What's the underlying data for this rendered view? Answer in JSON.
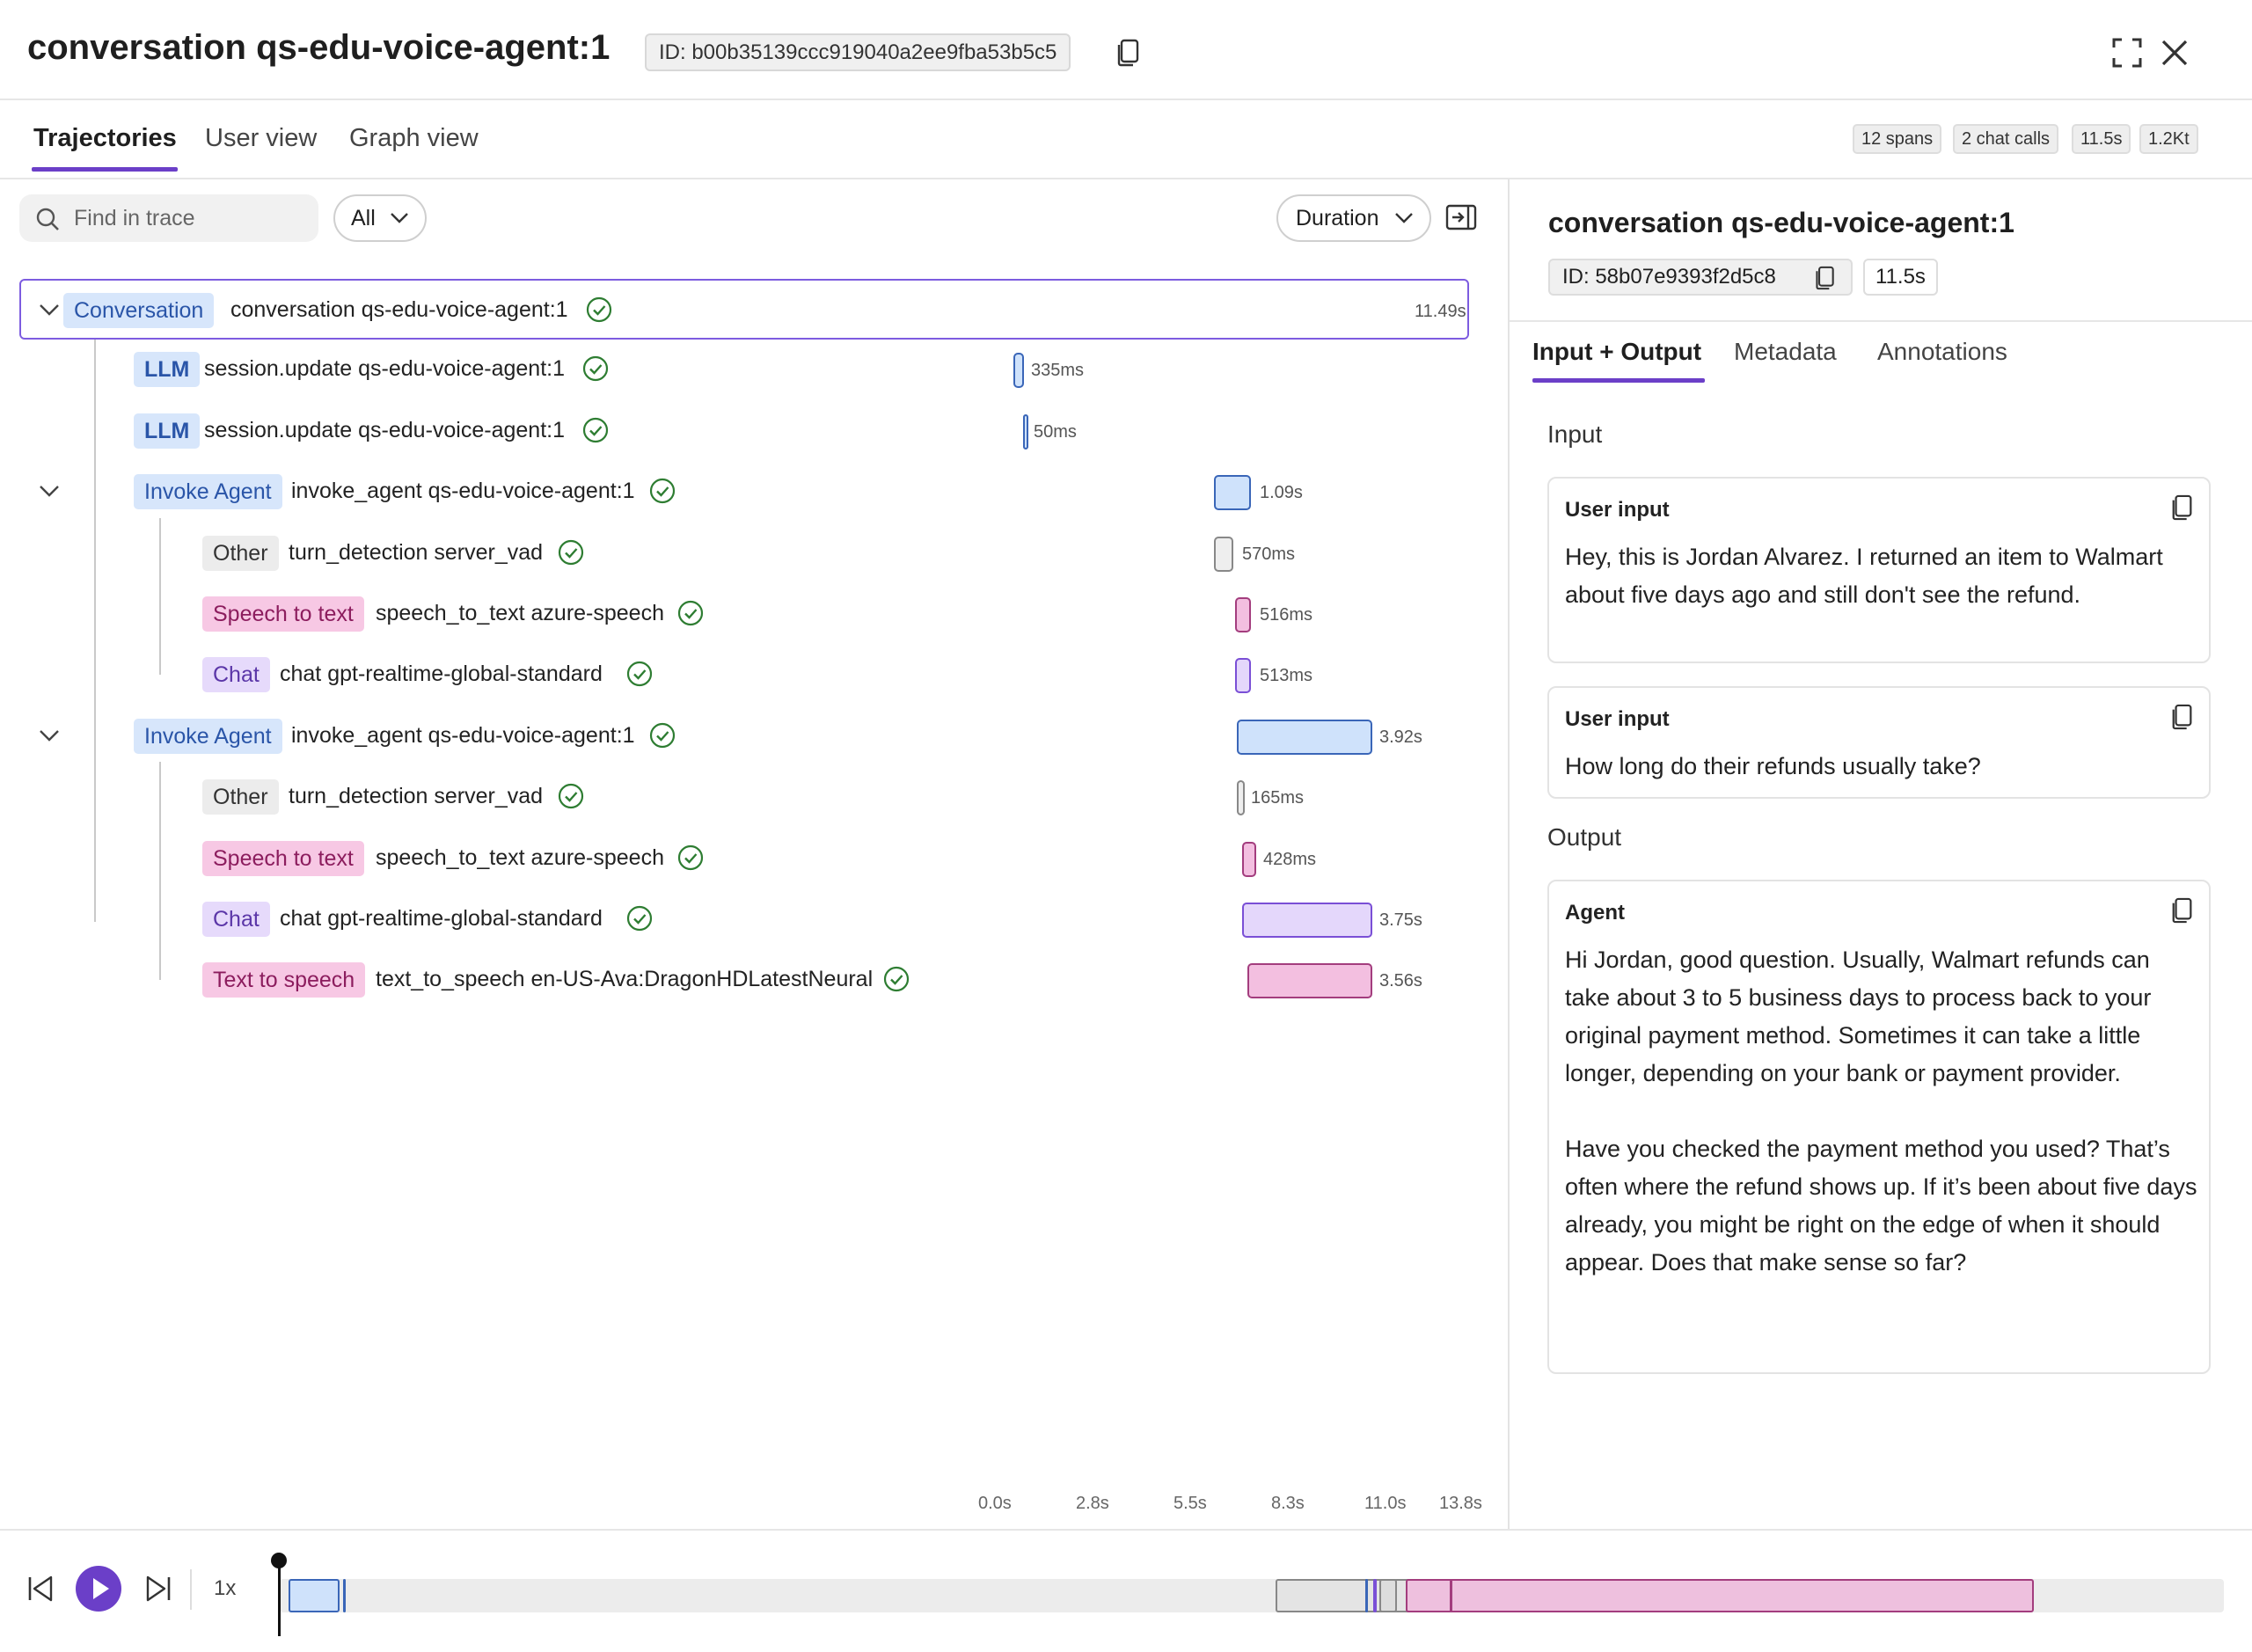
{
  "header": {
    "title": "conversation qs-edu-voice-agent:1",
    "id_label": "ID: b00b35139ccc919040a2ee9fba53b5c5"
  },
  "tabs": [
    {
      "label": "Trajectories",
      "active": true
    },
    {
      "label": "User view",
      "active": false
    },
    {
      "label": "Graph view",
      "active": false
    }
  ],
  "stats": [
    "12 spans",
    "2 chat calls",
    "11.5s",
    "1.2Kt"
  ],
  "toolbar": {
    "search_placeholder": "Find in trace",
    "filter_value": "All",
    "sort_value": "Duration"
  },
  "tree": [
    {
      "type": "Conversation",
      "name": "conversation qs-edu-voice-agent:1",
      "duration": "11.49s",
      "depth": 0,
      "expanded": true,
      "status": "ok",
      "selected": true,
      "color": "#cfe2fb"
    },
    {
      "type": "LLM",
      "name": "session.update qs-edu-voice-agent:1",
      "duration": "335ms",
      "depth": 1,
      "status": "ok",
      "color": "#cfe2fb"
    },
    {
      "type": "LLM",
      "name": "session.update qs-edu-voice-agent:1",
      "duration": "50ms",
      "depth": 1,
      "status": "ok",
      "color": "#cfe2fb"
    },
    {
      "type": "Invoke Agent",
      "name": "invoke_agent qs-edu-voice-agent:1",
      "duration": "1.09s",
      "depth": 1,
      "expanded": true,
      "status": "ok",
      "color": "#cfe2fb"
    },
    {
      "type": "Other",
      "name": "turn_detection server_vad",
      "duration": "570ms",
      "depth": 2,
      "status": "ok",
      "color": "#eeeeee"
    },
    {
      "type": "Speech to text",
      "name": "speech_to_text azure-speech",
      "duration": "516ms",
      "depth": 2,
      "status": "ok",
      "color": "#f3bfe0"
    },
    {
      "type": "Chat",
      "name": "chat gpt-realtime-global-standard",
      "duration": "513ms",
      "depth": 2,
      "status": "ok",
      "color": "#e4d7fb"
    },
    {
      "type": "Invoke Agent",
      "name": "invoke_agent qs-edu-voice-agent:1",
      "duration": "3.92s",
      "depth": 1,
      "expanded": true,
      "status": "ok",
      "color": "#cfe2fb"
    },
    {
      "type": "Other",
      "name": "turn_detection server_vad",
      "duration": "165ms",
      "depth": 2,
      "status": "ok",
      "color": "#eeeeee"
    },
    {
      "type": "Speech to text",
      "name": "speech_to_text azure-speech",
      "duration": "428ms",
      "depth": 2,
      "status": "ok",
      "color": "#f3bfe0"
    },
    {
      "type": "Chat",
      "name": "chat gpt-realtime-global-standard",
      "duration": "3.75s",
      "depth": 2,
      "status": "ok",
      "color": "#e4d7fb"
    },
    {
      "type": "Text to speech",
      "name": "text_to_speech en-US-Ava:DragonHDLatestNeural",
      "duration": "3.56s",
      "depth": 2,
      "status": "ok",
      "color": "#f3bfe0"
    }
  ],
  "axis_ticks": [
    "0.0s",
    "2.8s",
    "5.5s",
    "8.3s",
    "11.0s",
    "13.8s"
  ],
  "detail": {
    "title": "conversation qs-edu-voice-agent:1",
    "id_label": "ID: 58b07e9393f2d5c8",
    "duration": "11.5s",
    "tabs": [
      {
        "label": "Input + Output",
        "active": true
      },
      {
        "label": "Metadata",
        "active": false
      },
      {
        "label": "Annotations",
        "active": false
      }
    ],
    "input_label": "Input",
    "output_label": "Output",
    "inputs": [
      {
        "role": "User input",
        "text": "Hey, this is Jordan Alvarez. I returned an item to Walmart about five days ago and still don't see the refund."
      },
      {
        "role": "User input",
        "text": "How long do their refunds usually take?"
      }
    ],
    "output": {
      "role": "Agent",
      "text": "Hi Jordan, good question. Usually, Walmart refunds can take about 3 to 5 business days to process back to your original payment method. Sometimes it can take a little longer, depending on your bank or payment provider.\n\nHave you checked the payment method you used? That’s often where the refund shows up. If it’s been about five days already, you might be right on the edge of when it should appear. Does that make sense so far?"
    }
  },
  "player": {
    "speed": "1x"
  },
  "colors": {
    "accent": "#6b3fc8",
    "success": "#2e7d32",
    "llm_blue": "#cfe2fb",
    "speech_pink": "#f3bfe0",
    "chat_purple": "#e4d7fb",
    "other_gray": "#eeeeee"
  }
}
